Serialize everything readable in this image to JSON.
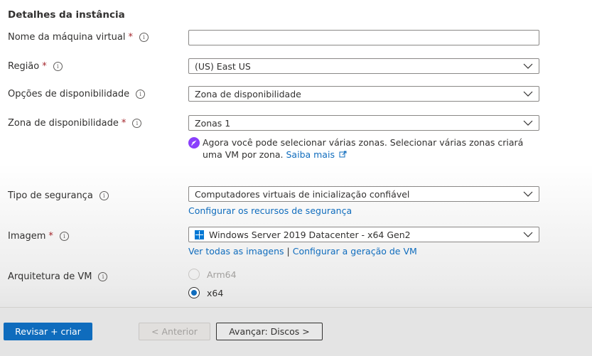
{
  "section": {
    "title": "Detalhes da instância"
  },
  "fields": {
    "vm_name": {
      "label": "Nome da máquina virtual",
      "required": "*",
      "value": ""
    },
    "region": {
      "label": "Região",
      "required": "*",
      "value": "(US) East US"
    },
    "availability_options": {
      "label": "Opções de disponibilidade",
      "value": "Zona de disponibilidade"
    },
    "availability_zone": {
      "label": "Zona de disponibilidade",
      "required": "*",
      "value": "Zonas 1",
      "note": "Agora você pode selecionar várias zonas. Selecionar várias zonas criará uma VM por zona.",
      "note_link": "Saiba mais"
    },
    "security_type": {
      "label": "Tipo de segurança",
      "value": "Computadores virtuais de inicialização confiável",
      "link": "Configurar os recursos de segurança"
    },
    "image": {
      "label": "Imagem",
      "required": "*",
      "value": "Windows Server 2019 Datacenter - x64 Gen2",
      "link_all": "Ver todas as imagens",
      "separator": "|",
      "link_config": "Configurar a geração de VM"
    },
    "vm_architecture": {
      "label": "Arquitetura de VM",
      "options": [
        {
          "label": "Arm64",
          "selected": false,
          "disabled": true
        },
        {
          "label": "x64",
          "selected": true,
          "disabled": false
        }
      ]
    }
  },
  "footer": {
    "review_create": "Revisar + criar",
    "previous": "< Anterior",
    "next": "Avançar: Discos >"
  },
  "icons": {
    "info": "info-icon",
    "chevron": "chevron-down-icon",
    "rocket": "rocket-icon",
    "external": "external-link-icon",
    "windows": "windows-logo-icon"
  },
  "colors": {
    "accent": "#0f6cbd",
    "required": "#a4262c",
    "note_icon": "#8a3ffc"
  }
}
